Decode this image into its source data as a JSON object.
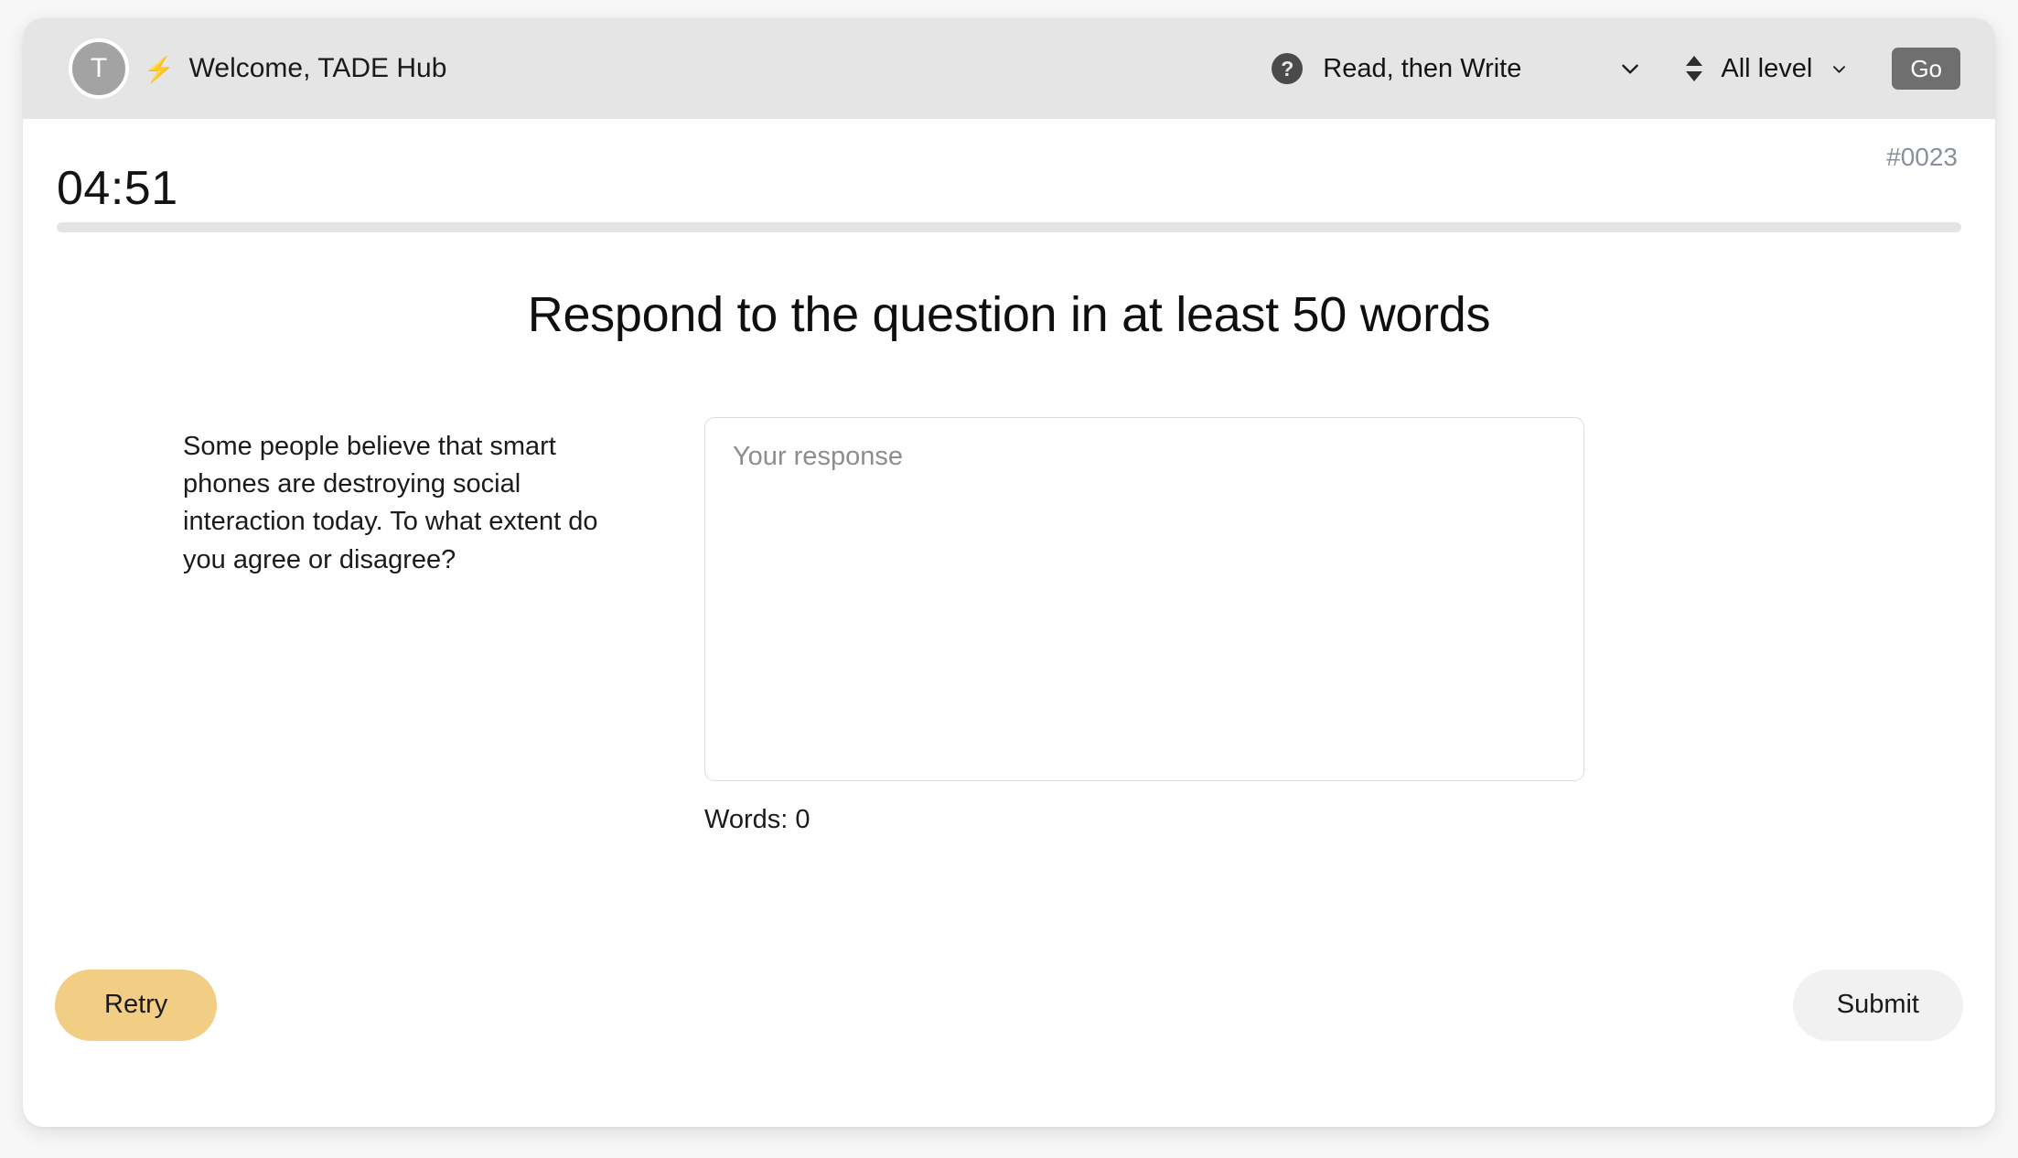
{
  "header": {
    "avatar_initial": "T",
    "bolt_icon": "bolt-icon",
    "welcome": "Welcome, TADE Hub",
    "help_icon_glyph": "?",
    "mode": {
      "label": "Read, then Write",
      "chevron": "chevron-down-icon"
    },
    "level": {
      "sort_icon": "sort-updown-icon",
      "label": "All level",
      "chevron": "chevron-down-icon"
    },
    "go_label": "Go"
  },
  "session": {
    "timer": "04:51",
    "question_id": "#0023",
    "progress_percent": 0
  },
  "task": {
    "title": "Respond to the question in at least 50 words",
    "question": "Some people believe that smart phones are destroying social interaction today. To what extent do you agree or disagree?"
  },
  "response": {
    "value": "",
    "placeholder": "Your response",
    "word_count_label": "Words: 0"
  },
  "actions": {
    "retry_label": "Retry",
    "submit_label": "Submit"
  },
  "colors": {
    "header_bg": "#e5e5e5",
    "accent_retry": "#f2ce85",
    "go_button": "#6f6f6f",
    "question_id": "#8a9099",
    "progress_track": "#e4e4e4"
  }
}
